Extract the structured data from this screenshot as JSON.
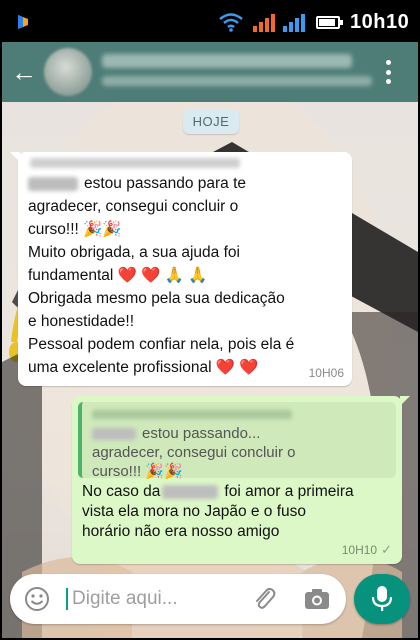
{
  "status_bar": {
    "time": "10h10",
    "battery_level": 1.0
  },
  "header": {
    "back_label": "←"
  },
  "chat": {
    "date_chip": "HOJE",
    "incoming": {
      "lines": [
        "estou passando para te",
        "agradecer, consegui concluir o",
        "curso!!! 🎉🎉",
        "Muito obrigada, a sua ajuda foi",
        "fundamental ❤️ ❤️ 🙏 🙏",
        "Obrigada mesmo pela sua dedicação",
        "e honestidade!!",
        "Pessoal podem confiar nela, pois ela é",
        "uma excelente profissional ❤️ ❤️"
      ],
      "time": "10H06"
    },
    "outgoing": {
      "quote_lines": [
        "estou passando...",
        "agradecer, consegui concluir o",
        "curso!!! 🎉🎉"
      ],
      "lines": [
        "No caso da",
        "foi amor a primeira",
        "vista ela mora no Japão e o fuso",
        "horário não era nosso amigo"
      ],
      "time": "10H10",
      "status_icon": "double-check-icon"
    }
  },
  "composer": {
    "placeholder": "Digite aqui..."
  },
  "colors": {
    "header": "#4e7d77",
    "mic": "#06927d",
    "outgoing_bubble": "#dcf8c6"
  }
}
